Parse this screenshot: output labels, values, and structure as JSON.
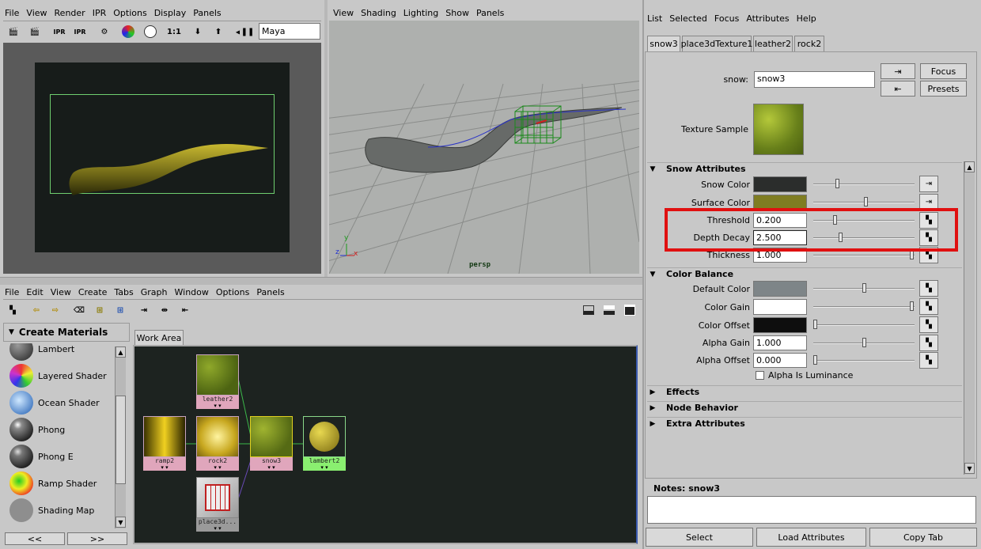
{
  "render_view": {
    "menu": [
      "File",
      "View",
      "Render",
      "IPR",
      "Options",
      "Display",
      "Panels"
    ],
    "toolbar_ratio": "1:1",
    "renderer": "Maya Software"
  },
  "persp_view": {
    "menu": [
      "View",
      "Shading",
      "Lighting",
      "Show",
      "Panels"
    ],
    "camera_label": "persp",
    "axis_x": "x",
    "axis_y": "y",
    "axis_z": "z"
  },
  "hypershade": {
    "menu": [
      "File",
      "Edit",
      "View",
      "Create",
      "Tabs",
      "Graph",
      "Window",
      "Options",
      "Panels"
    ],
    "create_header": "Create Materials",
    "materials": [
      {
        "label": "Lambert"
      },
      {
        "label": "Layered Shader"
      },
      {
        "label": "Ocean Shader"
      },
      {
        "label": "Phong"
      },
      {
        "label": "Phong E"
      },
      {
        "label": "Ramp Shader"
      },
      {
        "label": "Shading Map"
      }
    ],
    "scroll_left": "<<",
    "scroll_right": ">>",
    "work_area_tab": "Work Area",
    "nodes": {
      "leather": "leather2",
      "ramp": "ramp2",
      "rock": "rock2",
      "snow": "snow3",
      "lambert": "lambert2",
      "place": "place3d..."
    }
  },
  "attr_editor": {
    "menu": [
      "List",
      "Selected",
      "Focus",
      "Attributes",
      "Help"
    ],
    "tabs": [
      "snow3",
      "place3dTexture1",
      "leather2",
      "rock2"
    ],
    "node_label": "snow:",
    "node_value": "snow3",
    "focus_button": "Focus",
    "presets_button": "Presets",
    "texture_sample_label": "Texture Sample",
    "sections": {
      "snow_attributes": "Snow Attributes",
      "color_balance": "Color Balance",
      "effects": "Effects",
      "node_behavior": "Node Behavior",
      "extra_attributes": "Extra Attributes"
    },
    "snow_color_label": "Snow Color",
    "surface_color_label": "Surface Color",
    "threshold_label": "Threshold",
    "threshold_value": "0.200",
    "depth_decay_label": "Depth Decay",
    "depth_decay_value": "2.500",
    "thickness_label": "Thickness",
    "thickness_value": "1.000",
    "default_color_label": "Default Color",
    "color_gain_label": "Color Gain",
    "color_offset_label": "Color Offset",
    "alpha_gain_label": "Alpha Gain",
    "alpha_gain_value": "1.000",
    "alpha_offset_label": "Alpha Offset",
    "alpha_offset_value": "0.000",
    "alpha_is_luminance_label": "Alpha Is Luminance",
    "notes_label": "Notes:  snow3",
    "select_button": "Select",
    "load_attributes_button": "Load Attributes",
    "copy_tab_button": "Copy Tab",
    "colors": {
      "snow_color": "#2b2d2c",
      "surface_color": "#7f7d22",
      "default_color": "#7e8588",
      "color_gain": "#ffffff",
      "color_offset": "#0e0e0e",
      "highlight": "#e01010"
    }
  }
}
